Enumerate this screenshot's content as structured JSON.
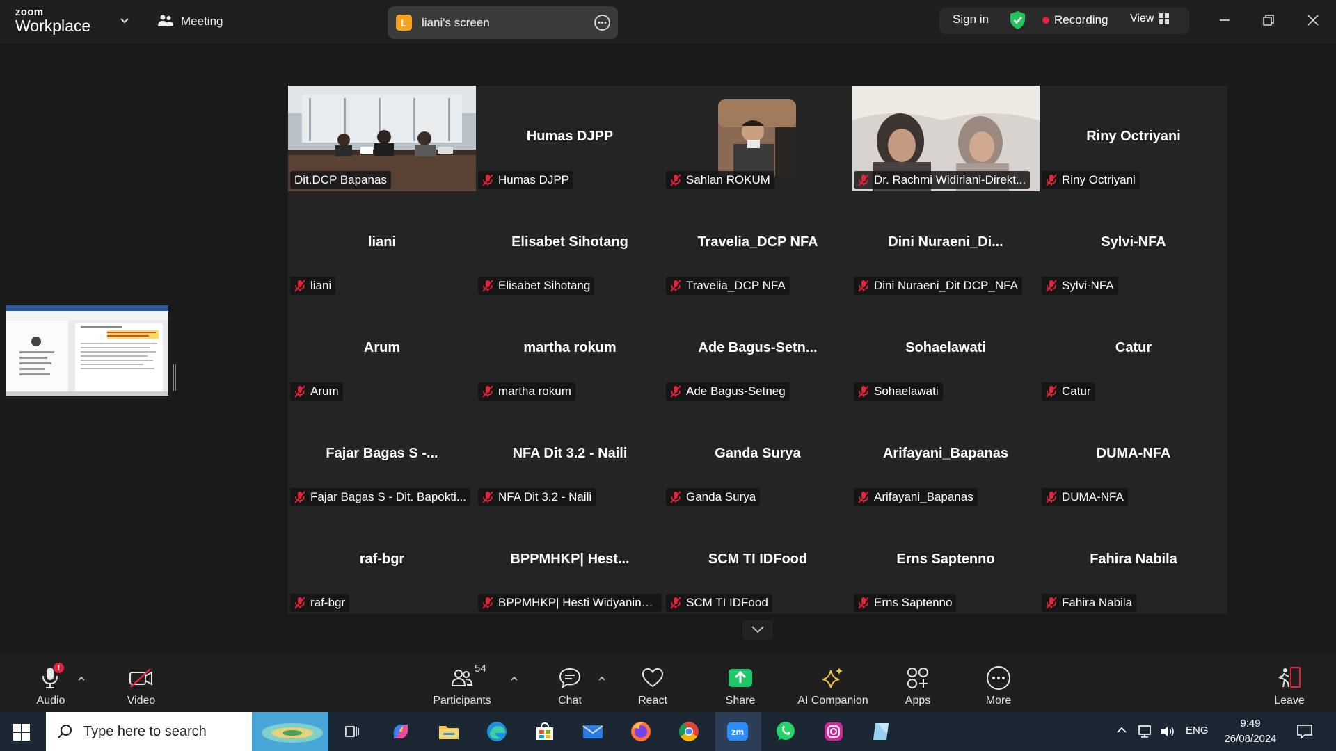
{
  "topbar": {
    "logo_line1": "zoom",
    "logo_line2": "Workplace",
    "meeting_label": "Meeting",
    "screen_share": {
      "initial": "L",
      "label": "liani's screen"
    },
    "sign_in": "Sign in",
    "recording": "Recording",
    "view": "View"
  },
  "gallery": {
    "tiles": [
      {
        "big": "",
        "label": "Dit.DCP Bapanas",
        "video": "room",
        "muted": false,
        "active": true
      },
      {
        "big": "Humas DJPP",
        "label": "Humas DJPP",
        "muted": true
      },
      {
        "big": "",
        "label": "Sahlan ROKUM",
        "video": "person",
        "muted": true
      },
      {
        "big": "",
        "label": "Dr. Rachmi Widiriani-Direkt...",
        "video": "two",
        "muted": true
      },
      {
        "big": "Riny Octriyani",
        "label": "Riny Octriyani",
        "muted": true
      },
      {
        "big": "liani",
        "label": "liani",
        "muted": true
      },
      {
        "big": "Elisabet Sihotang",
        "label": "Elisabet Sihotang",
        "muted": true
      },
      {
        "big": "Travelia_DCP NFA",
        "label": "Travelia_DCP NFA",
        "muted": true
      },
      {
        "big": "Dini  Nuraeni_Di...",
        "label": "Dini Nuraeni_Dit DCP_NFA",
        "muted": true
      },
      {
        "big": "Sylvi-NFA",
        "label": "Sylvi-NFA",
        "muted": true
      },
      {
        "big": "Arum",
        "label": "Arum",
        "muted": true
      },
      {
        "big": "martha rokum",
        "label": "martha rokum",
        "muted": true
      },
      {
        "big": "Ade  Bagus-Setn...",
        "label": "Ade Bagus-Setneg",
        "muted": true
      },
      {
        "big": "Sohaelawati",
        "label": "Sohaelawati",
        "muted": true
      },
      {
        "big": "Catur",
        "label": "Catur",
        "muted": true
      },
      {
        "big": "Fajar Bagas S -...",
        "label": "Fajar Bagas S - Dit. Bapokti...",
        "muted": true
      },
      {
        "big": "NFA Dit 3.2 - Naili",
        "label": "NFA Dit 3.2 - Naili",
        "muted": true
      },
      {
        "big": "Ganda Surya",
        "label": "Ganda Surya",
        "muted": true
      },
      {
        "big": "Arifayani_Bapanas",
        "label": "Arifayani_Bapanas",
        "muted": true
      },
      {
        "big": "DUMA-NFA",
        "label": "DUMA-NFA",
        "muted": true
      },
      {
        "big": "raf-bgr",
        "label": "raf-bgr",
        "muted": true
      },
      {
        "big": "BPPMHKP|  Hest...",
        "label": "BPPMHKP| Hesti Widyaning...",
        "muted": true
      },
      {
        "big": "SCM TI IDFood",
        "label": "SCM TI IDFood",
        "muted": true
      },
      {
        "big": "Erns Saptenno",
        "label": "Erns Saptenno",
        "muted": true
      },
      {
        "big": "Fahira Nabila",
        "label": "Fahira Nabila",
        "muted": true
      }
    ]
  },
  "toolbar": {
    "audio": "Audio",
    "audio_alert": "!",
    "video": "Video",
    "participants": "Participants",
    "participants_count": "54",
    "chat": "Chat",
    "react": "React",
    "share": "Share",
    "ai_companion": "AI Companion",
    "apps": "Apps",
    "more": "More",
    "leave": "Leave"
  },
  "taskbar": {
    "search_placeholder": "Type here to search",
    "language": "ENG",
    "time": "9:49",
    "date": "26/08/2024"
  },
  "colors": {
    "active_speaker": "#23d96a",
    "recording_dot": "#e5243b",
    "muted_icon": "#e5243b",
    "share_green": "#1fc66a"
  }
}
